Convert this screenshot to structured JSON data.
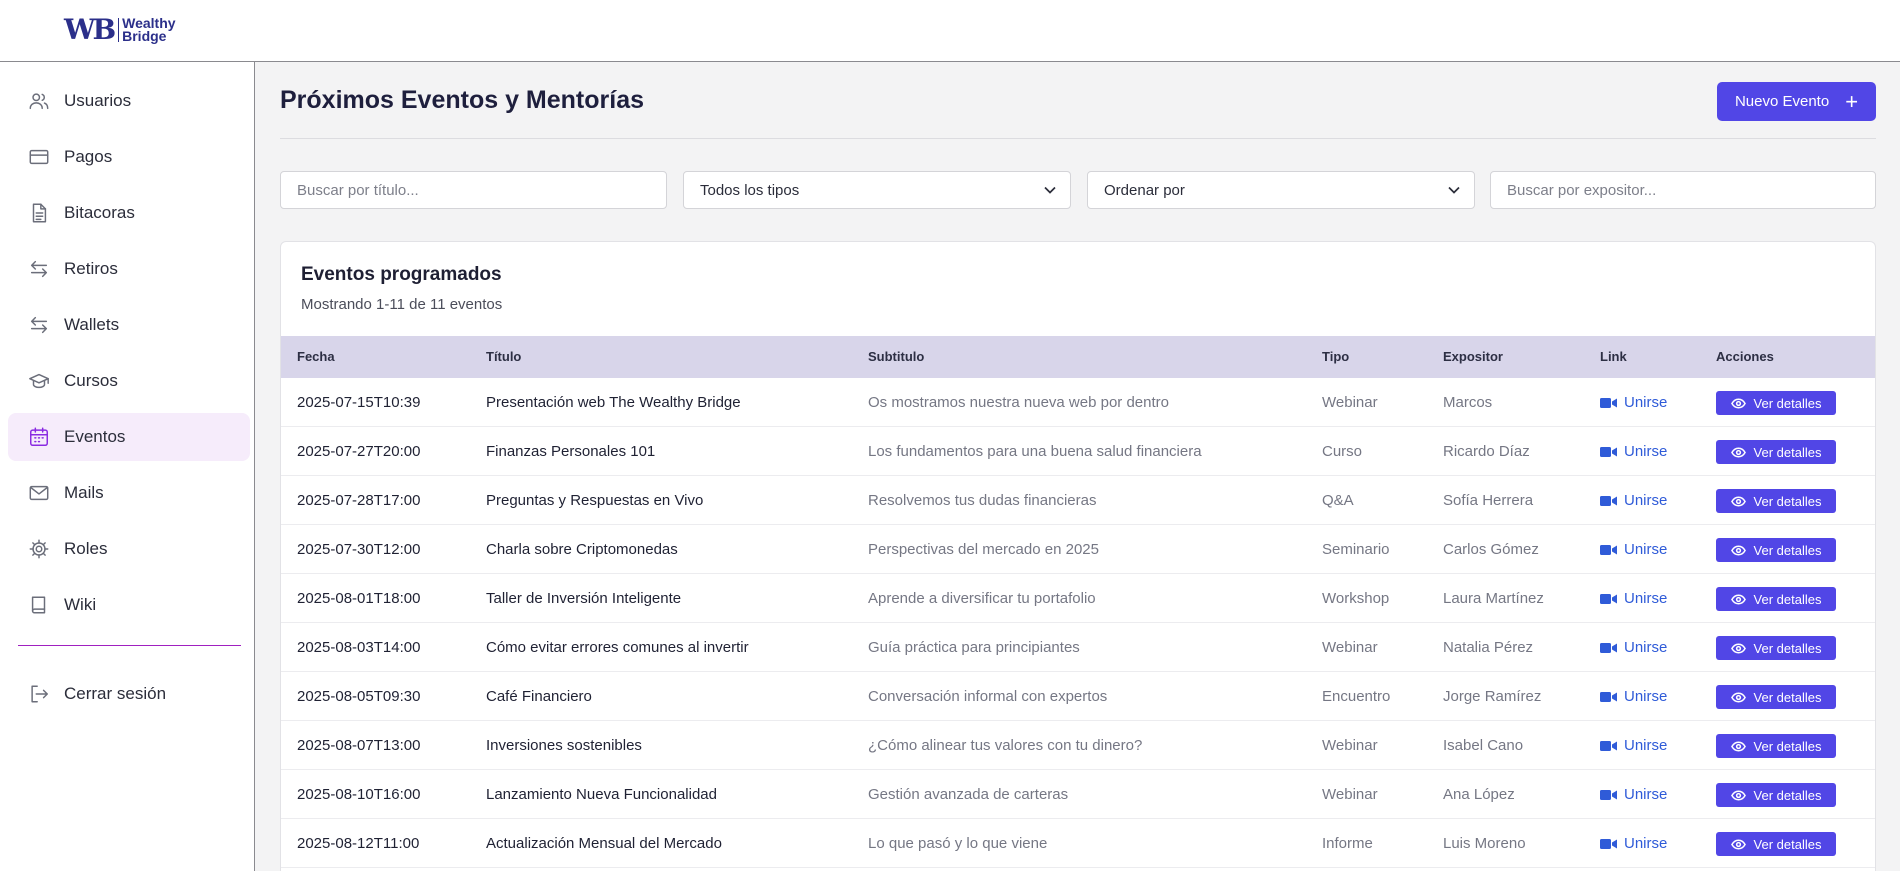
{
  "brand": {
    "mark": "WB",
    "name_line1": "Wealthy",
    "name_line2": "Bridge"
  },
  "sidebar": {
    "items": [
      {
        "label": "Usuarios",
        "icon": "users-icon"
      },
      {
        "label": "Pagos",
        "icon": "credit-card-icon"
      },
      {
        "label": "Bitacoras",
        "icon": "document-icon"
      },
      {
        "label": "Retiros",
        "icon": "arrows-exchange-icon"
      },
      {
        "label": "Wallets",
        "icon": "arrows-exchange-icon"
      },
      {
        "label": "Cursos",
        "icon": "graduation-cap-icon"
      },
      {
        "label": "Eventos",
        "icon": "calendar-icon",
        "active": true
      },
      {
        "label": "Mails",
        "icon": "mail-icon"
      },
      {
        "label": "Roles",
        "icon": "gear-icon"
      },
      {
        "label": "Wiki",
        "icon": "book-icon"
      }
    ],
    "logout": {
      "label": "Cerrar sesión",
      "icon": "logout-icon"
    }
  },
  "header": {
    "title": "Próximos Eventos y Mentorías",
    "new_button": "Nuevo Evento"
  },
  "filters": {
    "search_title_placeholder": "Buscar por título...",
    "type_select": "Todos los tipos",
    "order_select": "Ordenar por",
    "search_speaker_placeholder": "Buscar por expositor..."
  },
  "table": {
    "title": "Eventos programados",
    "subtitle": "Mostrando 1-11 de 11 eventos",
    "columns": [
      "Fecha",
      "Título",
      "Subtitulo",
      "Tipo",
      "Expositor",
      "Link",
      "Acciones"
    ],
    "link_label": "Unirse",
    "action_label": "Ver detalles",
    "rows": [
      {
        "fecha": "2025-07-15T10:39",
        "titulo": "Presentación web The Wealthy Bridge",
        "subtitulo": "Os mostramos nuestra nueva web por dentro",
        "tipo": "Webinar",
        "expositor": "Marcos"
      },
      {
        "fecha": "2025-07-27T20:00",
        "titulo": "Finanzas Personales 101",
        "subtitulo": "Los fundamentos para una buena salud financiera",
        "tipo": "Curso",
        "expositor": "Ricardo Díaz"
      },
      {
        "fecha": "2025-07-28T17:00",
        "titulo": "Preguntas y Respuestas en Vivo",
        "subtitulo": "Resolvemos tus dudas financieras",
        "tipo": "Q&A",
        "expositor": "Sofía Herrera"
      },
      {
        "fecha": "2025-07-30T12:00",
        "titulo": "Charla sobre Criptomonedas",
        "subtitulo": "Perspectivas del mercado en 2025",
        "tipo": "Seminario",
        "expositor": "Carlos Gómez"
      },
      {
        "fecha": "2025-08-01T18:00",
        "titulo": "Taller de Inversión Inteligente",
        "subtitulo": "Aprende a diversificar tu portafolio",
        "tipo": "Workshop",
        "expositor": "Laura Martínez"
      },
      {
        "fecha": "2025-08-03T14:00",
        "titulo": "Cómo evitar errores comunes al invertir",
        "subtitulo": "Guía práctica para principiantes",
        "tipo": "Webinar",
        "expositor": "Natalia Pérez"
      },
      {
        "fecha": "2025-08-05T09:30",
        "titulo": "Café Financiero",
        "subtitulo": "Conversación informal con expertos",
        "tipo": "Encuentro",
        "expositor": "Jorge Ramírez"
      },
      {
        "fecha": "2025-08-07T13:00",
        "titulo": "Inversiones sostenibles",
        "subtitulo": "¿Cómo alinear tus valores con tu dinero?",
        "tipo": "Webinar",
        "expositor": "Isabel Cano"
      },
      {
        "fecha": "2025-08-10T16:00",
        "titulo": "Lanzamiento Nueva Funcionalidad",
        "subtitulo": "Gestión avanzada de carteras",
        "tipo": "Webinar",
        "expositor": "Ana López"
      },
      {
        "fecha": "2025-08-12T11:00",
        "titulo": "Actualización Mensual del Mercado",
        "subtitulo": "Lo que pasó y lo que viene",
        "tipo": "Informe",
        "expositor": "Luis Moreno"
      }
    ]
  },
  "colors": {
    "accent": "#5146e6",
    "active_nav": "#8a2be2",
    "link": "#2f5bd8",
    "table_header": "#d8d5ea"
  }
}
